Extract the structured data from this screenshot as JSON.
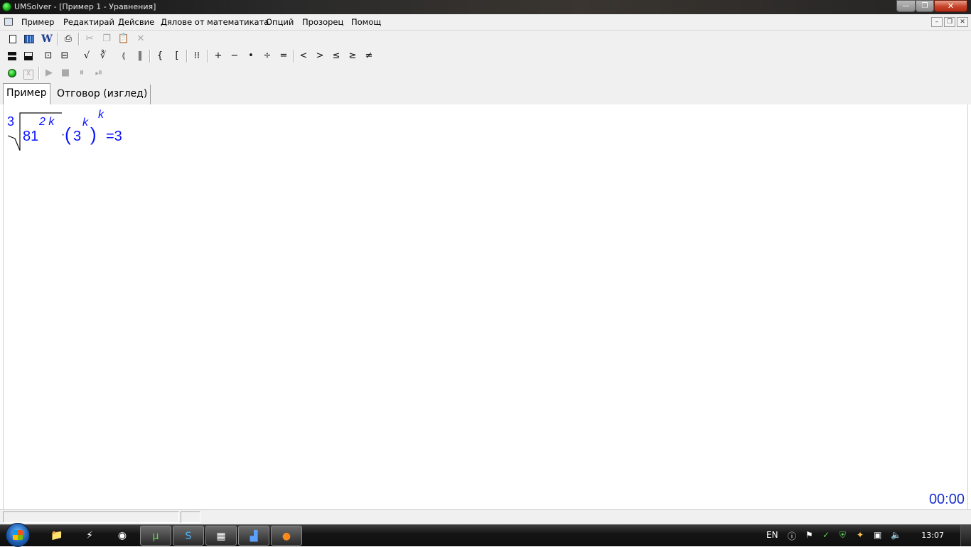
{
  "window": {
    "title": "UMSolver - [Пример 1 - Уравнения]",
    "minimize_glyph": "—",
    "maximize_glyph": "❐",
    "close_glyph": "✕"
  },
  "menu": {
    "items": [
      "Пример",
      "Редактирай",
      "Дейсвие",
      "Дялове от математиката",
      "Опций",
      "Прозорец",
      "Помощ"
    ],
    "mdi_minimize": "–",
    "mdi_restore": "❐",
    "mdi_close": "✕"
  },
  "toolbar2": {
    "brace": "{",
    "bracket": "[",
    "plus": "+",
    "minus": "−",
    "dot": "•",
    "divide": "÷",
    "equals": "=",
    "lt": "<",
    "gt": ">",
    "le": "≤",
    "ge": "≥",
    "ne": "≠"
  },
  "tabs": [
    {
      "label": "Пример",
      "active": true
    },
    {
      "label": "Отговор (изглед)",
      "active": false
    }
  ],
  "equation": {
    "root_index": "3",
    "base": "81",
    "base_exponent": "2 k",
    "inner_base": "3",
    "inner_exponent": "k",
    "outer_exponent": "k",
    "rhs": "=3"
  },
  "timer": "00:00",
  "taskbar": {
    "language": "EN",
    "clock": "13:07"
  },
  "colors": {
    "equation": "#0a14ff",
    "timer": "#1a2fd0"
  }
}
